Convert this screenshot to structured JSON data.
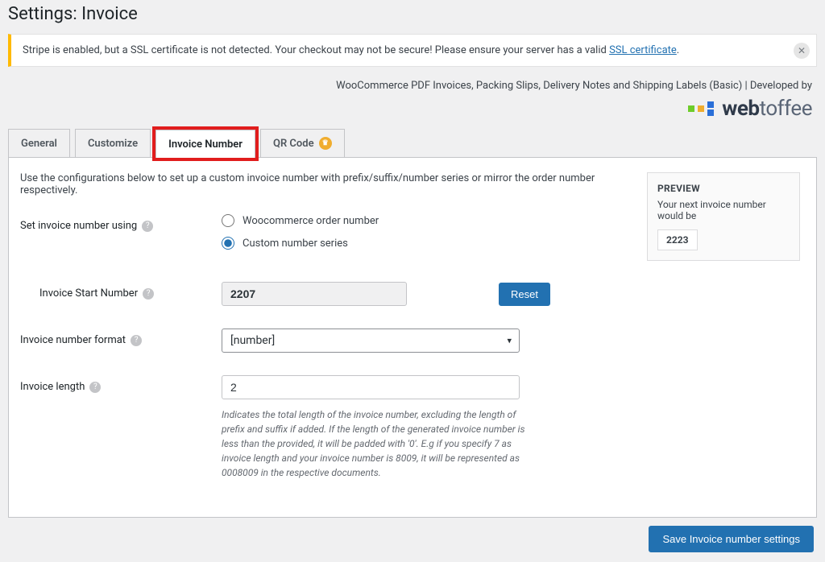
{
  "page_title": "Settings: Invoice",
  "notice": {
    "text_before": "Stripe is enabled, but a SSL certificate is not detected. Your checkout may not be secure! Please ensure your server has a valid ",
    "link_text": "SSL certificate",
    "text_after": "."
  },
  "dev_credit": "WooCommerce PDF Invoices, Packing Slips, Delivery Notes and Shipping Labels (Basic) | Developed by",
  "logo": {
    "brand1": "web",
    "brand2": "toffee"
  },
  "tabs": {
    "general": "General",
    "customize": "Customize",
    "invoice_number": "Invoice Number",
    "qr_code": "QR Code"
  },
  "intro": "Use the configurations below to set up a custom invoice number with prefix/suffix/number series or mirror the order number respectively.",
  "preview": {
    "title": "PREVIEW",
    "sub": "Your next invoice number would be",
    "value": "2223"
  },
  "form": {
    "set_using_label": "Set invoice number using",
    "radio_woo": "Woocommerce order number",
    "radio_custom": "Custom number series",
    "start_label": "Invoice Start Number",
    "start_value": "2207",
    "reset_label": "Reset",
    "format_label": "Invoice number format",
    "format_value": "[number]",
    "length_label": "Invoice length",
    "length_value": "2",
    "length_help": "Indicates the total length of the invoice number, excluding the length of prefix and suffix if added. If the length of the generated invoice number is less than the provided, it will be padded with '0'. E.g if you specify 7 as invoice length and your invoice number is 8009, it will be represented as 0008009 in the respective documents."
  },
  "save_label": "Save Invoice number settings"
}
